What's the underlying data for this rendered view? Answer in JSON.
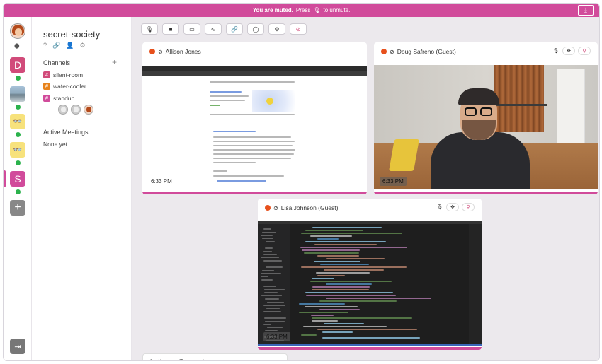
{
  "banner": {
    "muted_text": "You are muted.",
    "press_text": "Press",
    "unmute_text": "to unmute.",
    "download_icon": "download-icon"
  },
  "rail": {
    "servers": [
      {
        "letter": "D",
        "color": "#d14b7a"
      },
      {
        "letter": "",
        "color": "#8fa9bc"
      },
      {
        "letter": "",
        "color": "#f7e27c"
      },
      {
        "letter": "",
        "color": "#f7e27c"
      },
      {
        "letter": "S",
        "color": "#d14b9b"
      }
    ],
    "add_label": "+",
    "status_online_color": "#2bb24c"
  },
  "sidebar": {
    "team_name": "secret-society",
    "channels_title": "Channels",
    "add_channel": "+",
    "channels": [
      {
        "name": "silent-room",
        "color": "#d14b7a"
      },
      {
        "name": "water-cooler",
        "color": "#e7831c"
      },
      {
        "name": "standup",
        "color": "#d14b9b"
      }
    ],
    "meetings_title": "Active Meetings",
    "meetings_empty": "None yet"
  },
  "tiles": [
    {
      "name": "Allison Jones",
      "time": "6:33 PM"
    },
    {
      "name": "Doug Safreno (Guest)",
      "time": "6:33 PM"
    },
    {
      "name": "Lisa Johnson (Guest)",
      "time": "6:33 PM"
    }
  ],
  "invite": {
    "text": "Invite your Teammates"
  },
  "colors": {
    "accent": "#d14b9b",
    "recording": "#e7501c"
  }
}
